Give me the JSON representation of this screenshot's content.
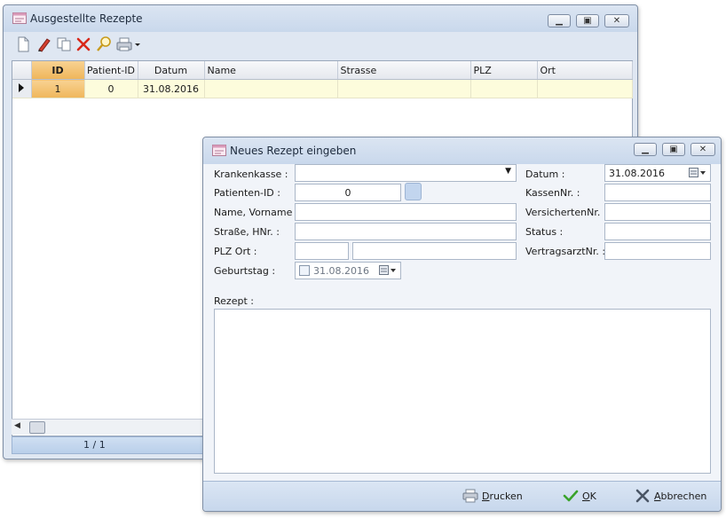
{
  "window_main": {
    "title": "Ausgestellte Rezepte",
    "toolbar": [
      "new-icon",
      "edit-icon",
      "copy-icon",
      "delete-icon",
      "search-icon",
      "print-icon"
    ],
    "grid": {
      "columns": [
        "ID",
        "Patient-ID",
        "Datum",
        "Name",
        "Strasse",
        "PLZ",
        "Ort"
      ],
      "rows": [
        {
          "id": "1",
          "patient_id": "0",
          "datum": "31.08.2016",
          "name": "",
          "strasse": "",
          "plz": "",
          "ort": ""
        }
      ]
    },
    "pager": "1 / 1"
  },
  "dialog": {
    "title": "Neues Rezept eingeben",
    "labels": {
      "krankenkasse": "Krankenkasse :",
      "patienten_id": "Patienten-ID :",
      "name": "Name, Vorname :",
      "strasse": "Straße, HNr. :",
      "plz_ort": "PLZ Ort :",
      "geburtstag": "Geburtstag :",
      "datum": "Datum :",
      "kassen_nr": "KassenNr. :",
      "versicherten_nr": "VersichertenNr. :",
      "status": "Status :",
      "vertragsarzt_nr": "VertragsarztNr. :",
      "rezept": "Rezept :"
    },
    "values": {
      "krankenkasse": "",
      "patienten_id": "0",
      "name": "",
      "strasse": "",
      "plz": "",
      "ort": "",
      "geburtstag": "31.08.2016",
      "datum": "31.08.2016",
      "kassen_nr": "",
      "versicherten_nr": "",
      "status": "",
      "vertragsarzt_nr": "",
      "rezept": ""
    },
    "buttons": {
      "drucken": {
        "pre": "",
        "mn": "D",
        "post": "rucken"
      },
      "ok": {
        "pre": "",
        "mn": "O",
        "post": "K"
      },
      "abbrechen": {
        "pre": "",
        "mn": "A",
        "post": "bbrechen"
      }
    }
  },
  "colors": {
    "title_bar": "#c9d8ec",
    "selected_row": "#fdfcdc",
    "id_column": "#efb65b"
  }
}
